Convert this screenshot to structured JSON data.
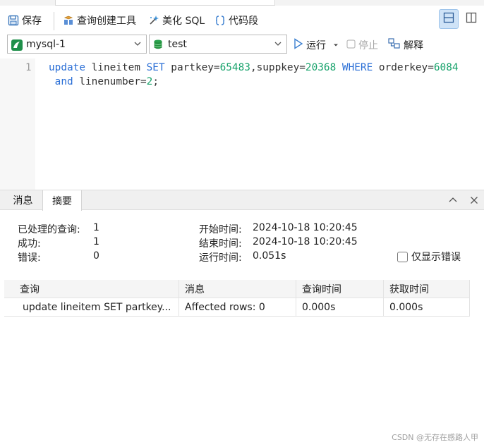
{
  "toolbar": {
    "save": "保存",
    "query_builder": "查询创建工具",
    "beautify_sql": "美化 SQL",
    "code_snippet": "代码段",
    "run": "运行",
    "stop": "停止",
    "explain": "解释"
  },
  "connection": {
    "selected": "mysql-1"
  },
  "database": {
    "selected": "test"
  },
  "editor": {
    "line_number": "1",
    "line1": {
      "kw_update": "update",
      "t1": " lineitem ",
      "kw_set": "SET",
      "t2": " partkey=",
      "n1": "65483",
      "t3": ",suppkey=",
      "n2": "20368",
      "t4": " ",
      "kw_where": "WHERE",
      "t5": " orderkey=",
      "n3": "6084"
    },
    "line2": {
      "t0": " ",
      "kw_and": "and",
      "t1": " linenumber=",
      "n1": "2",
      "t2": ";"
    }
  },
  "result_tabs": [
    "消息",
    "摘要"
  ],
  "summary": {
    "processed_label": "已处理的查询:",
    "processed_value": "1",
    "success_label": "成功:",
    "success_value": "1",
    "error_label": "错误:",
    "error_value": "0",
    "start_label": "开始时间:",
    "start_value": "2024-10-18 10:20:45",
    "end_label": "结束时间:",
    "end_value": "2024-10-18 10:20:45",
    "runtime_label": "运行时间:",
    "runtime_value": "0.051s",
    "only_errors": "仅显示错误"
  },
  "table": {
    "headers": [
      "查询",
      "消息",
      "查询时间",
      "获取时间"
    ],
    "rows": [
      [
        "update lineitem SET partkey...",
        "Affected rows: 0",
        "0.000s",
        "0.000s"
      ]
    ]
  },
  "watermark": "CSDN @无存在感路人甲",
  "colors": {
    "keyword": "#2b6fd6",
    "number": "#17a26b",
    "active_layout": "#cfe3f7"
  }
}
